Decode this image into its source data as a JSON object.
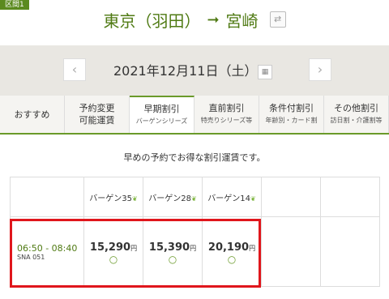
{
  "section_badge": "区間1",
  "route": {
    "from": "東京（羽田）",
    "arrow": "➞",
    "to": "宮崎",
    "swap_icon": "⇄"
  },
  "date_bar": {
    "prev": "‹",
    "date": "2021年12月11日（土）",
    "next": "›",
    "calendar_icon": "▦"
  },
  "tabs": [
    {
      "label": "おすすめ",
      "sub": ""
    },
    {
      "label": "予約変更\n可能運賃",
      "sub": ""
    },
    {
      "label": "早期割引",
      "sub": "バーゲンシリーズ"
    },
    {
      "label": "直前割引",
      "sub": "特売りシリーズ等"
    },
    {
      "label": "条件付割引",
      "sub": "年齢別・カード割"
    },
    {
      "label": "その他割引",
      "sub": "訪日割・介護割等"
    }
  ],
  "note": "早めの予約でお得な割引運賃です。",
  "fare_headers": [
    "バーゲン35",
    "バーゲン28",
    "バーゲン14"
  ],
  "leaf_icon": "❦",
  "flight": {
    "time": "06:50 - 08:40",
    "code": "SNA 051"
  },
  "fares": [
    {
      "price": "15,290",
      "unit": "円",
      "avail": "○"
    },
    {
      "price": "15,390",
      "unit": "円",
      "avail": "○"
    },
    {
      "price": "20,190",
      "unit": "円",
      "avail": "○"
    }
  ]
}
